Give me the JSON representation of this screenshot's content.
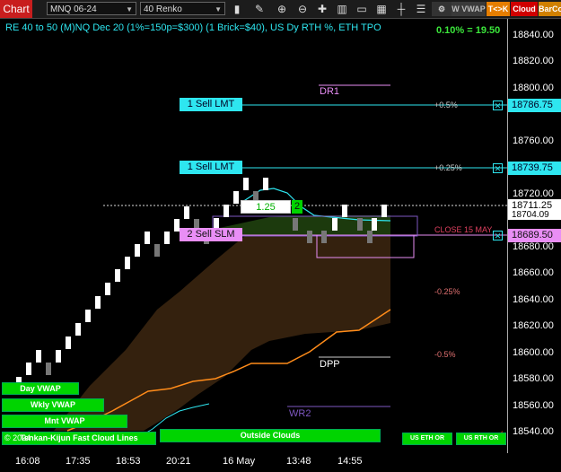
{
  "toolbar": {
    "app_label": "Chart",
    "instrument": "MNQ 06-24",
    "bar_type": "40 Renko",
    "vvwap_label": "W VWAP",
    "tk_label": "T<>K",
    "cloud_label": "Cloud",
    "barcol_label": "BarCo",
    "icons": [
      "bar-style-icon",
      "draw-pencil-icon",
      "zoom-in-icon",
      "zoom-out-icon",
      "crosshair-icon",
      "bar-chart-icon",
      "data-box-icon",
      "grid-icon",
      "ruler-icon",
      "properties-icon"
    ]
  },
  "chart": {
    "title": "RE 40 to 50 (M)NQ Dec 20 (1%=150p=$300) (1 Brick=$40), US Dy RTH %, ETH TPO",
    "pct_readout": "0.10% = 19.50",
    "y_labels": [
      "18840.00",
      "18820.00",
      "18800.00",
      "18780.00",
      "18760.00",
      "18740.00",
      "18720.00",
      "18700.00",
      "18680.00",
      "18660.00",
      "18640.00",
      "18620.00",
      "18600.00",
      "18580.00",
      "18560.00",
      "18540.00"
    ],
    "x_labels": [
      "16:08",
      "17:35",
      "18:53",
      "20:21",
      "16 May",
      "13:48",
      "14:55"
    ],
    "orders": [
      {
        "label": "1 Sell LMT",
        "price": "18786.75",
        "pct": "+0.5%"
      },
      {
        "label": "1 Sell LMT",
        "price": "18739.75",
        "pct": "+0.25%"
      },
      {
        "label": "2 Sell SLM",
        "price": "18689.50",
        "pct": "CLOSE 15 MAY"
      }
    ],
    "position_qty": "2",
    "position_pnl": "1.25",
    "last_price": "18711.25",
    "hidden_price": "18704.09",
    "levels": {
      "dr1": "DR1",
      "dpp": "DPP",
      "wr2": "WR2",
      "neg025": "-0.25%",
      "neg05": "-0.5%"
    },
    "bottom_buttons": {
      "day_vwap": "Day VWAP",
      "wkly_vwap": "Wkly VWAP",
      "mnt_vwap": "Mnt VWAP",
      "tenkan": "Tenkan-Kijun Fast Cloud Lines",
      "outside_clouds": "Outside Clouds",
      "us_eth_or": "US ETH OR",
      "us_rth_or": "US RTH OR"
    },
    "copyright": "© 2024"
  },
  "colors": {
    "accent_cyan": "#2ee6f0",
    "order_pink": "#e98ef5",
    "button_green": "#00d400",
    "dpp_orange": "#ff8c1a"
  }
}
